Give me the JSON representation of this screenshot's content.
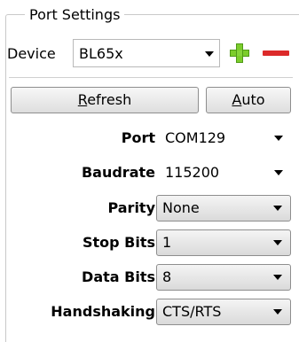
{
  "group": {
    "title": "Port Settings"
  },
  "device": {
    "label": "Device",
    "value": "BL65x",
    "add_icon": "plus-icon",
    "remove_icon": "minus-icon"
  },
  "buttons": {
    "refresh_mnemonic": "R",
    "refresh_rest": "efresh",
    "auto_mnemonic": "A",
    "auto_rest": "uto"
  },
  "fields": {
    "port": {
      "label": "Port",
      "value": "COM129"
    },
    "baudrate": {
      "label": "Baudrate",
      "value": "115200"
    },
    "parity": {
      "label": "Parity",
      "value": "None"
    },
    "stop_bits": {
      "label": "Stop Bits",
      "value": "1"
    },
    "data_bits": {
      "label": "Data Bits",
      "value": "8"
    },
    "handshaking": {
      "label": "Handshaking",
      "value": "CTS/RTS"
    }
  },
  "colors": {
    "add": "#7ccd2c",
    "remove": "#dc2a2a"
  }
}
